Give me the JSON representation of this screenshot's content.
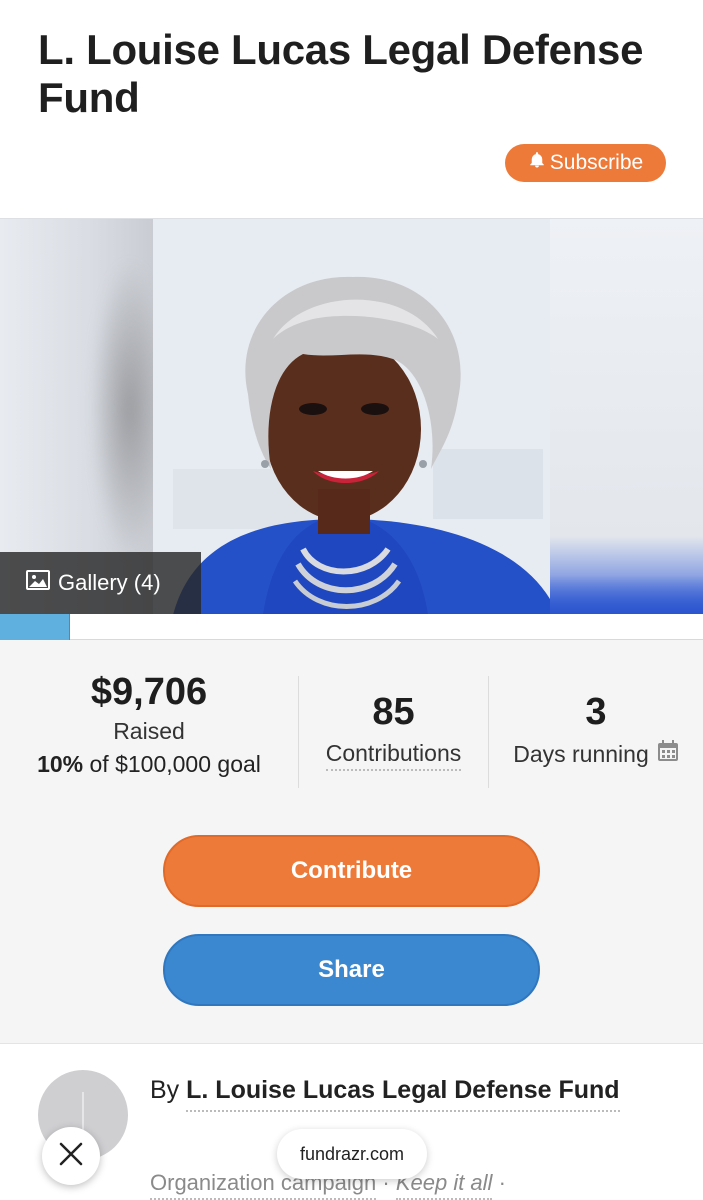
{
  "page": {
    "title": "L. Louise Lucas Legal Defense Fund"
  },
  "header": {
    "subscribe_label": "Subscribe",
    "subscribe_icon": "bell-icon"
  },
  "gallery": {
    "label": "Gallery (4)",
    "icon": "image-icon"
  },
  "progress": {
    "percent": 10
  },
  "stats": {
    "raised_amount": "$9,706",
    "raised_label": "Raised",
    "goal_percent": "10%",
    "goal_text": "of $100,000 goal",
    "contributions_count": "85",
    "contributions_label": "Contributions",
    "days_count": "3",
    "days_label": "Days running",
    "days_icon": "calendar-icon"
  },
  "actions": {
    "contribute_label": "Contribute",
    "share_label": "Share"
  },
  "organizer": {
    "by_prefix": "By",
    "name": "L. Louise Lucas Legal Defense Fund",
    "type": "Organization campaign",
    "separator": "·",
    "policy": "Keep it all",
    "trailing": "·"
  },
  "browser": {
    "url": "fundrazr.com",
    "close_icon": "close-icon"
  },
  "colors": {
    "accent_orange": "#ee7a3a",
    "accent_blue": "#3b88d0",
    "progress_blue": "#5fb0df"
  }
}
